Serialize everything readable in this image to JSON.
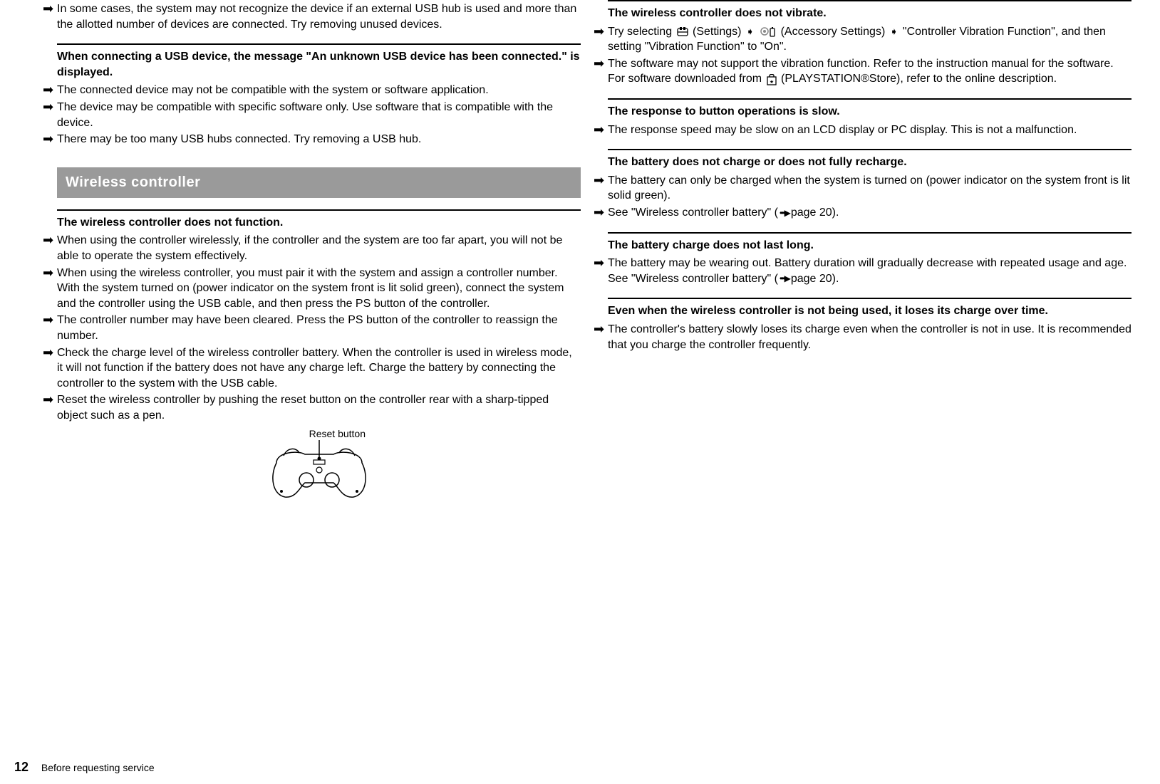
{
  "left": {
    "topBullet": "In some cases, the system may not recognize the device if an external USB hub is used and more than the allotted number of devices are connected. Try removing unused devices.",
    "usbUnknown": {
      "heading": "When connecting a USB device, the message \"An unknown USB device has been connected.\" is displayed.",
      "items": [
        "The connected device may not be compatible with the system or software application.",
        "The device may be compatible with specific software only. Use software that is compatible with the device.",
        "There may be too many USB hubs connected. Try removing a USB hub."
      ]
    },
    "sectionBar": "Wireless controller",
    "noFunction": {
      "heading": "The wireless controller does not function.",
      "items": [
        "When using the controller wirelessly, if the controller and the system are too far apart, you will not be able to operate the system effectively.",
        "When using the wireless controller, you must pair it with the system and assign a controller number. With the system turned on (power indicator on the system front is lit solid green), connect the system and the controller using the USB cable, and then press the PS button of the controller.",
        "The controller number may have been cleared. Press the PS button of the controller to reassign the number.",
        "Check the charge level of the wireless controller battery. When the controller is used in wireless mode, it will not function if the battery does not have any charge left. Charge the battery by connecting the controller to the system with the USB cable.",
        "Reset the wireless controller by pushing the reset button on the controller rear with a sharp-tipped object such as a pen."
      ]
    },
    "figureLabel": "Reset button"
  },
  "right": {
    "noVibrate": {
      "heading": "The wireless controller does not vibrate.",
      "item1_pre": "Try selecting ",
      "item1_settings": " (Settings) ",
      "item1_accessory": " (Accessory Settings) ",
      "item1_post": " \"Controller Vibration Function\", and then setting \"Vibration Function\" to \"On\".",
      "item2_pre": "The software may not support the vibration function. Refer to the instruction manual for the software. For software downloaded from ",
      "item2_post": " (PLAYSTATION®Store), refer to the online description."
    },
    "slow": {
      "heading": "The response to button operations is slow.",
      "items": [
        "The response speed may be slow on an LCD display or PC display. This is not a malfunction."
      ]
    },
    "noCharge": {
      "heading": "The battery does not charge or does not fully recharge.",
      "item1": "The battery can only be charged when the system is turned on (power indicator on the system front is lit solid green).",
      "item2_pre": "See \"Wireless controller battery\" (",
      "item2_post": "page 20)."
    },
    "shortCharge": {
      "heading": "The battery charge does not last long.",
      "item_pre": "The battery may be wearing out. Battery duration will gradually decrease with repeated usage and age. See \"Wireless controller battery\" (",
      "item_post": "page 20)."
    },
    "idleDrain": {
      "heading": "Even when the wireless controller is not being used, it loses its charge over time.",
      "items": [
        "The controller's battery slowly loses its charge even when the controller is not in use. It is recommended that you charge the controller frequently."
      ]
    }
  },
  "footer": {
    "pageNumber": "12",
    "text": "Before requesting service"
  }
}
